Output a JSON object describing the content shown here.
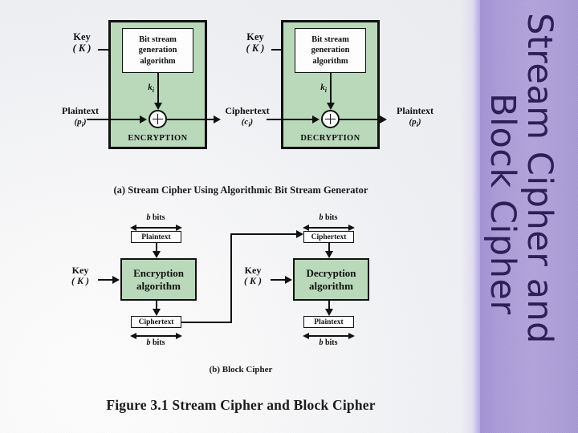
{
  "slide": {
    "sidebar": {
      "line1": "Stream Cipher and",
      "line2": "Block Cipher",
      "bg_color": "#ab9bd9",
      "text_color": "#2f1f58"
    }
  },
  "figure": {
    "caption": "Figure 3.1  Stream Cipher and Block Cipher",
    "part_a_caption": "(a) Stream Cipher Using Algorithmic Bit Stream Generator",
    "part_b_caption": "(b) Block Cipher",
    "green_fill": "#b9d9ba",
    "stroke": "#111111"
  },
  "stream_cipher": {
    "encryption": {
      "key_label": "Key",
      "key_sub": "( K )",
      "generator_line1": "Bit stream",
      "generator_line2": "generation",
      "generator_line3": "algorithm",
      "keystream_label": "k",
      "keystream_sub": "i",
      "input_label": "Plaintext",
      "input_sub": "(p",
      "input_sub2": "i",
      "input_sub3": ")",
      "block_label": "ENCRYPTION",
      "output_label": "Ciphertext",
      "output_sub": "(c",
      "output_sub2": "i",
      "output_sub3": ")",
      "operator": "XOR"
    },
    "decryption": {
      "key_label": "Key",
      "key_sub": "( K )",
      "generator_line1": "Bit stream",
      "generator_line2": "generation",
      "generator_line3": "algorithm",
      "keystream_label": "k",
      "keystream_sub": "i",
      "block_label": "DECRYPTION",
      "output_label": "Plaintext",
      "output_sub": "(p",
      "output_sub2": "i",
      "output_sub3": ")",
      "operator": "XOR"
    }
  },
  "block_cipher": {
    "encryption": {
      "bits_label_top": "b bits",
      "bits_label_bottom": "b bits",
      "bits_italic": "b",
      "bits_word": "bits",
      "input_box": "Plaintext",
      "algorithm_line1": "Encryption",
      "algorithm_line2": "algorithm",
      "key_label": "Key",
      "key_sub": "( K )",
      "output_box": "Ciphertext"
    },
    "decryption": {
      "bits_label_top": "b bits",
      "bits_label_bottom": "b bits",
      "bits_italic": "b",
      "bits_word": "bits",
      "input_box": "Ciphertext",
      "algorithm_line1": "Decryption",
      "algorithm_line2": "algorithm",
      "key_label": "Key",
      "key_sub": "( K )",
      "output_box": "Plaintext"
    }
  }
}
